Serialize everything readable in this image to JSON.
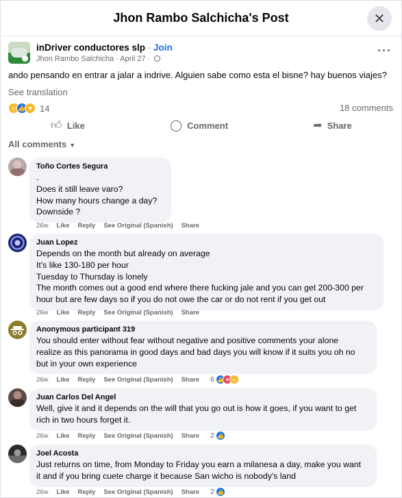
{
  "header": {
    "title": "Jhon Rambo Salchicha's Post",
    "close_icon": "close-icon"
  },
  "post": {
    "group_name": "inDriver conductores slp",
    "separator": " · ",
    "join_label": "Join",
    "author": "Jhon Rambo Salchicha",
    "date": "April 27",
    "text": "ando pensando en entrar a jalar a indrive. Alguien sabe como esta el bisne? hay buenos viajes?",
    "see_translation": "See translation",
    "reactions_count": "14",
    "comments_count": "18 comments",
    "actions": {
      "like": "Like",
      "comment": "Comment",
      "share": "Share"
    }
  },
  "filter": {
    "label": "All comments"
  },
  "comments": [
    {
      "name": "Toño Cortes Segura",
      "lines": [
        ".",
        "Does it still leave varo?",
        "How many hours change a day?",
        "Downside ?"
      ],
      "time": "26w",
      "like": "Like",
      "reply": "Reply",
      "see_original": "See Original (Spanish)",
      "share": "Share",
      "reaction_count": ""
    },
    {
      "name": "Juan Lopez",
      "lines": [
        "Depends on the month but already on average",
        "It's like 130-180 per hour",
        "Tuesday to Thursday is lonely",
        "The month comes out a good end where there fucking jale and you can get 200-300 per",
        "hour but are few days so if you do not owe the car or do not rent if you get out"
      ],
      "time": "26w",
      "like": "Like",
      "reply": "Reply",
      "see_original": "See Original (Spanish)",
      "share": "Share",
      "reaction_count": ""
    },
    {
      "name": "Anonymous participant 319",
      "lines": [
        "You should enter without fear without negative and positive comments your alone",
        "realize as this panorama in good days and bad days you will know if it suits you oh no",
        "but in your own experience"
      ],
      "time": "26w",
      "like": "Like",
      "reply": "Reply",
      "see_original": "See Original (Spanish)",
      "share": "Share",
      "reaction_count": "6"
    },
    {
      "name": "Juan Carlos Del Angel",
      "lines": [
        "Well, give it and it depends on the will that you go out is how it goes, if you want to get",
        "rich in two hours forget it."
      ],
      "time": "26w",
      "like": "Like",
      "reply": "Reply",
      "see_original": "See Original (Spanish)",
      "share": "Share",
      "reaction_count": "2"
    },
    {
      "name": "Joel Acosta",
      "lines": [
        "Just returns on time, from Monday to Friday you earn a milanesa a day, make you want",
        "it and if you bring cuete charge it because San wicho is nobody's land"
      ],
      "time": "26w",
      "like": "Like",
      "reply": "Reply",
      "see_original": "See Original (Spanish)",
      "share": "Share",
      "reaction_count": "2"
    }
  ],
  "colors": {
    "link": "#1b74e4",
    "like_blue": "#1877f2",
    "bubble": "#f0f2f5",
    "secondary": "#65676b"
  }
}
